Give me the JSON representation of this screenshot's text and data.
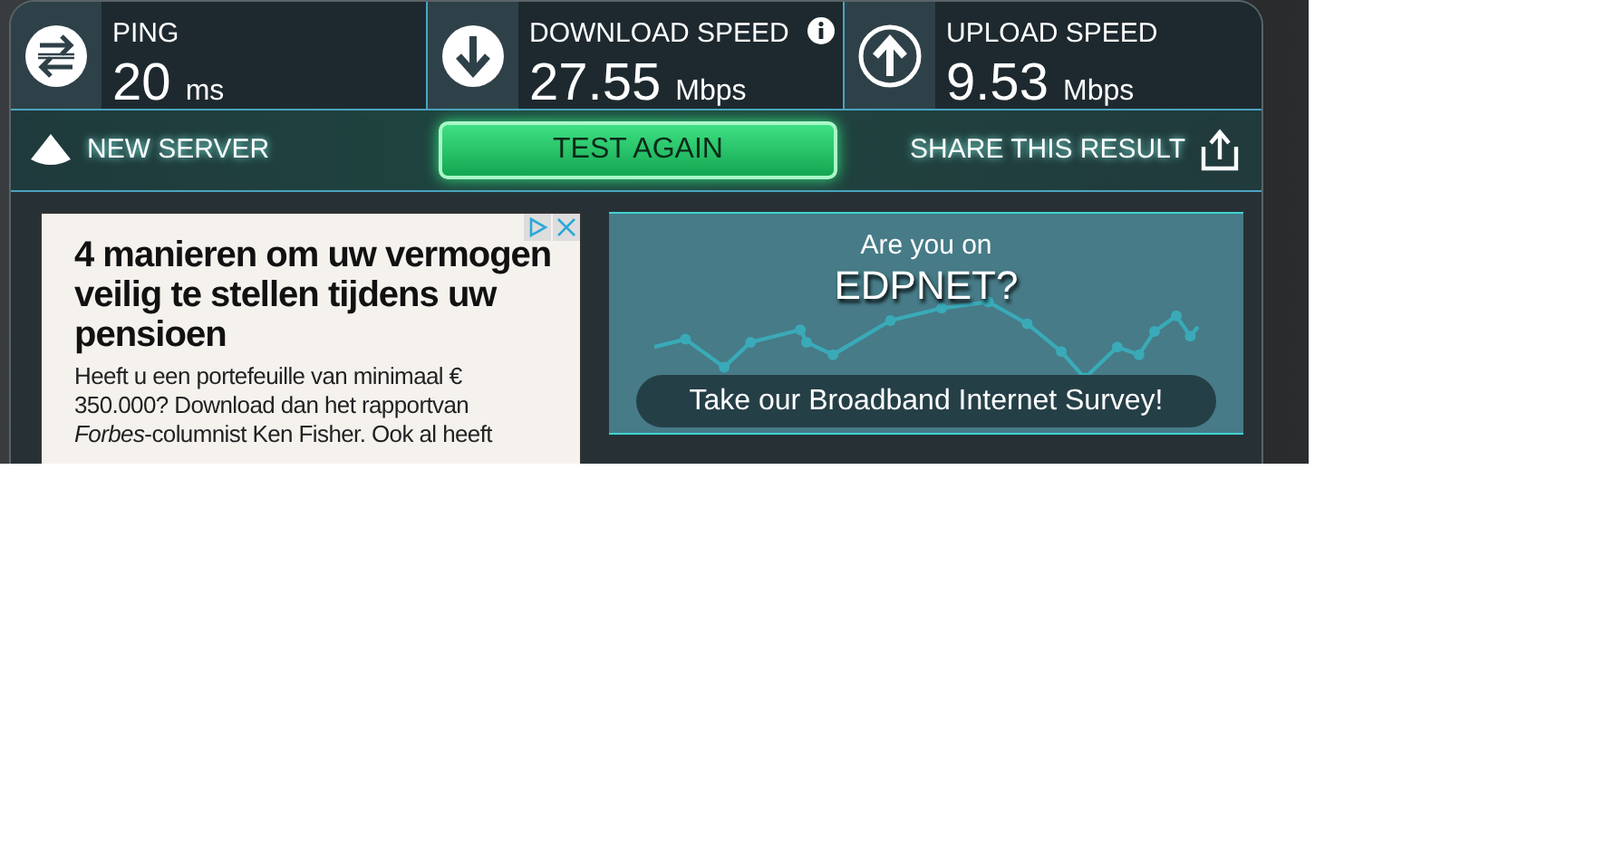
{
  "metrics": [
    {
      "kind": "ping",
      "label": "PING",
      "value": "20",
      "unit": "ms",
      "info": false
    },
    {
      "kind": "download",
      "label": "DOWNLOAD SPEED",
      "value": "27.55",
      "unit": "Mbps",
      "info": true
    },
    {
      "kind": "upload",
      "label": "UPLOAD SPEED",
      "value": "9.53",
      "unit": "Mbps",
      "info": false
    }
  ],
  "actions": {
    "new_server": "NEW SERVER",
    "test_again": "TEST AGAIN",
    "share": "SHARE THIS RESULT"
  },
  "ad": {
    "headline": "4 manieren om uw vermogen veilig te stellen tijdens uw pensioen",
    "body": "Heeft u een portefeuille van minimaal € 350.000? Download dan het rapportvan *Forbes*-columnist Ken Fisher. Ook al heeft"
  },
  "survey": {
    "question": "Are you on",
    "provider": "EDPNET?",
    "button": "Take our Broadband Internet Survey!"
  }
}
